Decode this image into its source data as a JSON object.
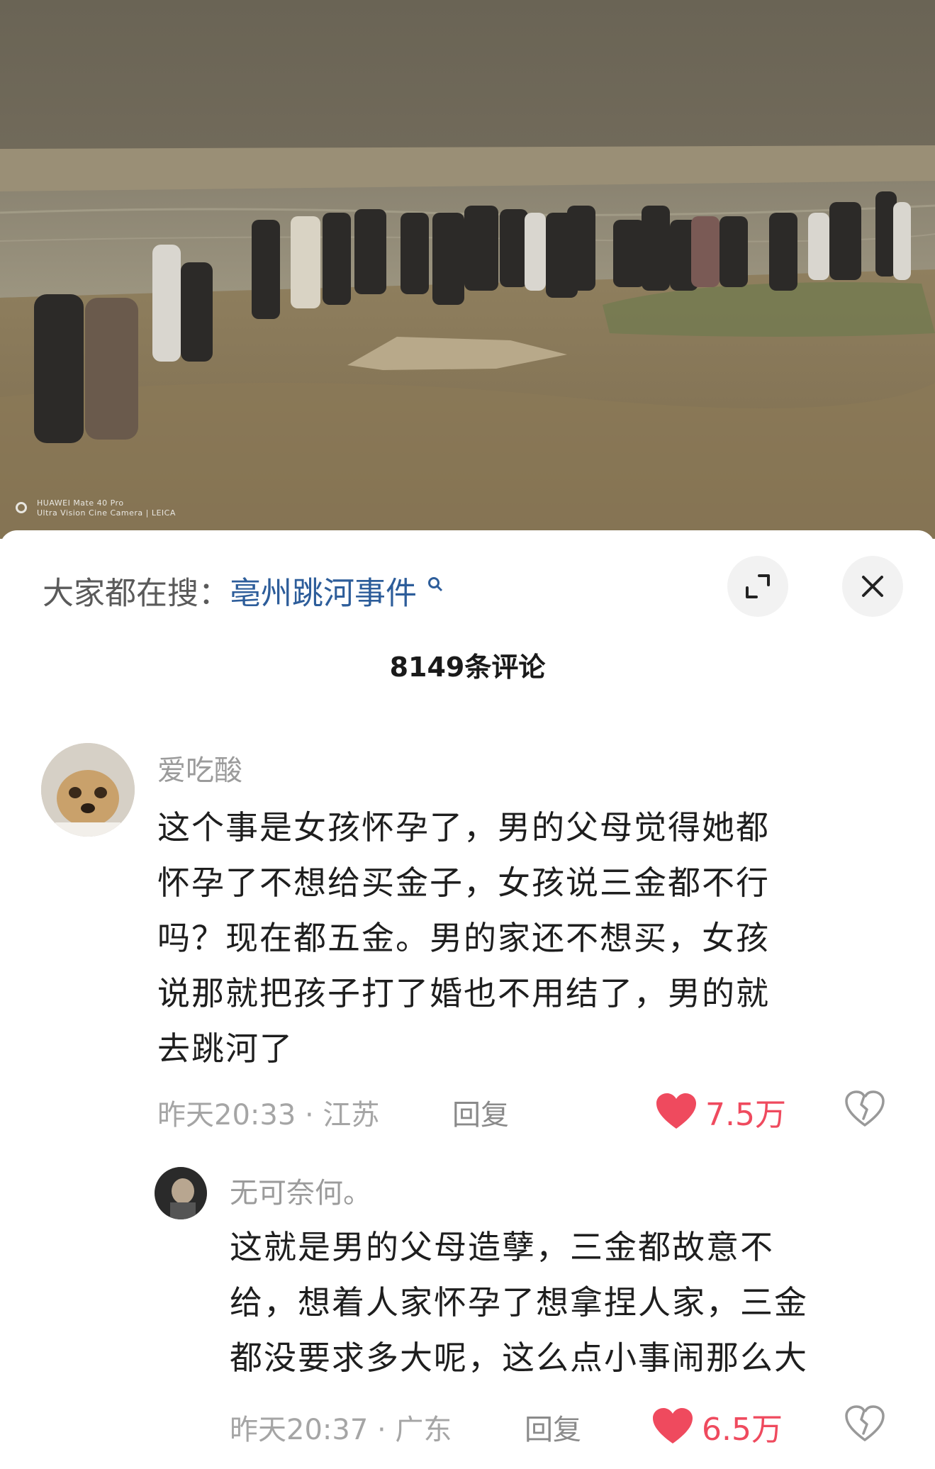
{
  "photo": {
    "watermark_line1": "HUAWEI Mate 40 Pro",
    "watermark_line2": "Ultra Vision Cine Camera | LEICA"
  },
  "sheet": {
    "search_prefix": "大家都在搜：",
    "search_term": "亳州跳河事件",
    "comment_count": "8149条评论"
  },
  "comments": [
    {
      "username": "爱吃酸",
      "lines": [
        "这个事是女孩怀孕了，男的父母觉得她都",
        "怀孕了不想给买金子，女孩说三金都不行",
        "吗？现在都五金。男的家还不想买，女孩",
        "说那就把孩子打了婚也不用结了，男的就",
        "去跳河了"
      ],
      "meta": "昨天20:33 · 江苏",
      "reply_label": "回复",
      "likes": "7.5万"
    },
    {
      "username": "无可奈何。",
      "lines": [
        "这就是男的父母造孽，三金都故意不",
        "给，想着人家怀孕了想拿捏人家，三金",
        "都没要求多大呢，这么点小事闹那么大"
      ],
      "meta": "昨天20:37 · 广东",
      "reply_label": "回复",
      "likes": "6.5万"
    }
  ],
  "colors": {
    "search_term": "#2d5d9a",
    "like": "#ef4a5e",
    "muted": "#a5a5a5"
  },
  "icons": {
    "expand": "expand-icon",
    "close": "close-icon",
    "search": "search-icon",
    "like": "heart-icon",
    "dislike": "broken-heart-icon"
  }
}
